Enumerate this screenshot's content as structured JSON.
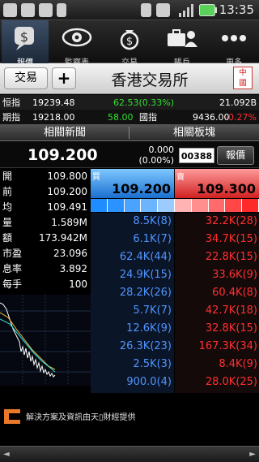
{
  "status_bar": {
    "time": "13:35",
    "icons": [
      "chat-icon",
      "bag-icon",
      "gmail-icon",
      "usb-icon",
      "vibrate-icon",
      "mute-icon",
      "signal-icon",
      "battery-icon"
    ]
  },
  "nav": {
    "tabs": [
      {
        "label": "報價",
        "icon": "quote-icon",
        "active": true
      },
      {
        "label": "監察表",
        "icon": "eye-icon",
        "active": false
      },
      {
        "label": "交易",
        "icon": "money-bag-icon",
        "active": false
      },
      {
        "label": "賬戶",
        "icon": "account-icon",
        "active": false
      },
      {
        "label": "更多",
        "icon": "more-icon",
        "active": false
      }
    ]
  },
  "titlebar": {
    "trade_label": "交易",
    "plus_label": "+",
    "title": "香港交易所",
    "badge": "中\n國"
  },
  "indices": {
    "row1": {
      "name": "恒指",
      "value": "19239.48",
      "change": "62.53(0.33%)",
      "turnover": "21.092B"
    },
    "row2": {
      "name": "期指",
      "value": "19218.00",
      "change": "58.00",
      "name2": "國指",
      "value2": "9436.00",
      "change2": "-0.27%"
    }
  },
  "subtabs": {
    "news": "相關新聞",
    "sector": "相關板塊"
  },
  "quote": {
    "price": "109.200",
    "change": "0.000",
    "change_pct": "(0.00%)",
    "code": "00388",
    "report_label": "報價"
  },
  "stats": [
    {
      "label": "開",
      "value": "109.800"
    },
    {
      "label": "前",
      "value": "109.200"
    },
    {
      "label": "均",
      "value": "109.491"
    },
    {
      "label": "量",
      "value": "1.589M"
    },
    {
      "label": "額",
      "value": "173.942M"
    },
    {
      "label": "市盈",
      "value": "23.096"
    },
    {
      "label": "息率",
      "value": "3.892"
    },
    {
      "label": "每手",
      "value": "100"
    }
  ],
  "orderbook": {
    "bid_label": "買",
    "ask_label": "賣",
    "bid_price": "109.200",
    "ask_price": "109.300",
    "depth_colors": [
      "#1f8cff",
      "#2a93ff",
      "#4aa3ff",
      "#6db4ff",
      "#9ccbff",
      "#ffb3b3",
      "#ff8e8e",
      "#ff6a6a",
      "#ff4747",
      "#ff2a2a"
    ],
    "bids": [
      "8.5K(8)",
      "6.1K(7)",
      "62.4K(44)",
      "24.9K(15)",
      "28.2K(26)",
      "5.7K(7)",
      "12.6K(9)",
      "26.3K(23)",
      "2.5K(3)",
      "900.0(4)"
    ],
    "asks": [
      "32.2K(28)",
      "34.7K(15)",
      "22.8K(15)",
      "33.6K(9)",
      "60.4K(8)",
      "42.7K(18)",
      "32.8K(15)",
      "167.3K(34)",
      "8.4K(9)",
      "28.0K(25)"
    ]
  },
  "footer": {
    "text": "解決方案及資訊由天▯財經提供",
    "left_arrow": "◄",
    "right_arrow": "►"
  },
  "colors": {
    "up": "#2fe02f",
    "down": "#ff3030",
    "bid_blue": "#4f95ff"
  }
}
